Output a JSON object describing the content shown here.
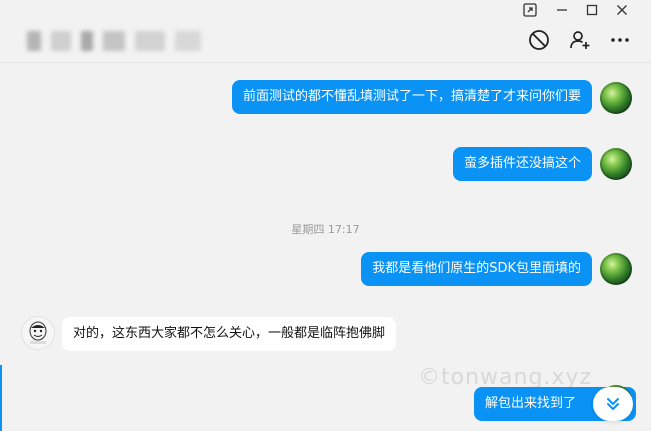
{
  "window": {
    "controls": [
      "pin-icon",
      "minimize-icon",
      "maximize-icon",
      "close-icon"
    ]
  },
  "header": {
    "title": "",
    "actions": [
      "block-icon",
      "add-user-icon",
      "more-icon"
    ]
  },
  "messages": [
    {
      "sender": "me",
      "text": "前面测试的都不懂乱填测试了一下，搞清楚了才来问你们要"
    },
    {
      "sender": "me",
      "text": "蛮多插件还没搞这个"
    },
    {
      "sender": "me",
      "text": "我都是看他们原生的SDK包里面填的"
    },
    {
      "sender": "them",
      "text": "对的，这东西大家都不怎么关心，一般都是临阵抱佛脚"
    },
    {
      "sender": "me",
      "text": "解包出来找到了"
    }
  ],
  "timestamp": "星期四 17:17",
  "watermark": "©tonwang.xyz",
  "colors": {
    "my_bubble": "#0a93f5",
    "their_bubble": "#ffffff",
    "background": "#f2f2f2",
    "accent": "#0a93f5"
  },
  "icons": {
    "scroll_down": "double-chevron-down-icon"
  }
}
